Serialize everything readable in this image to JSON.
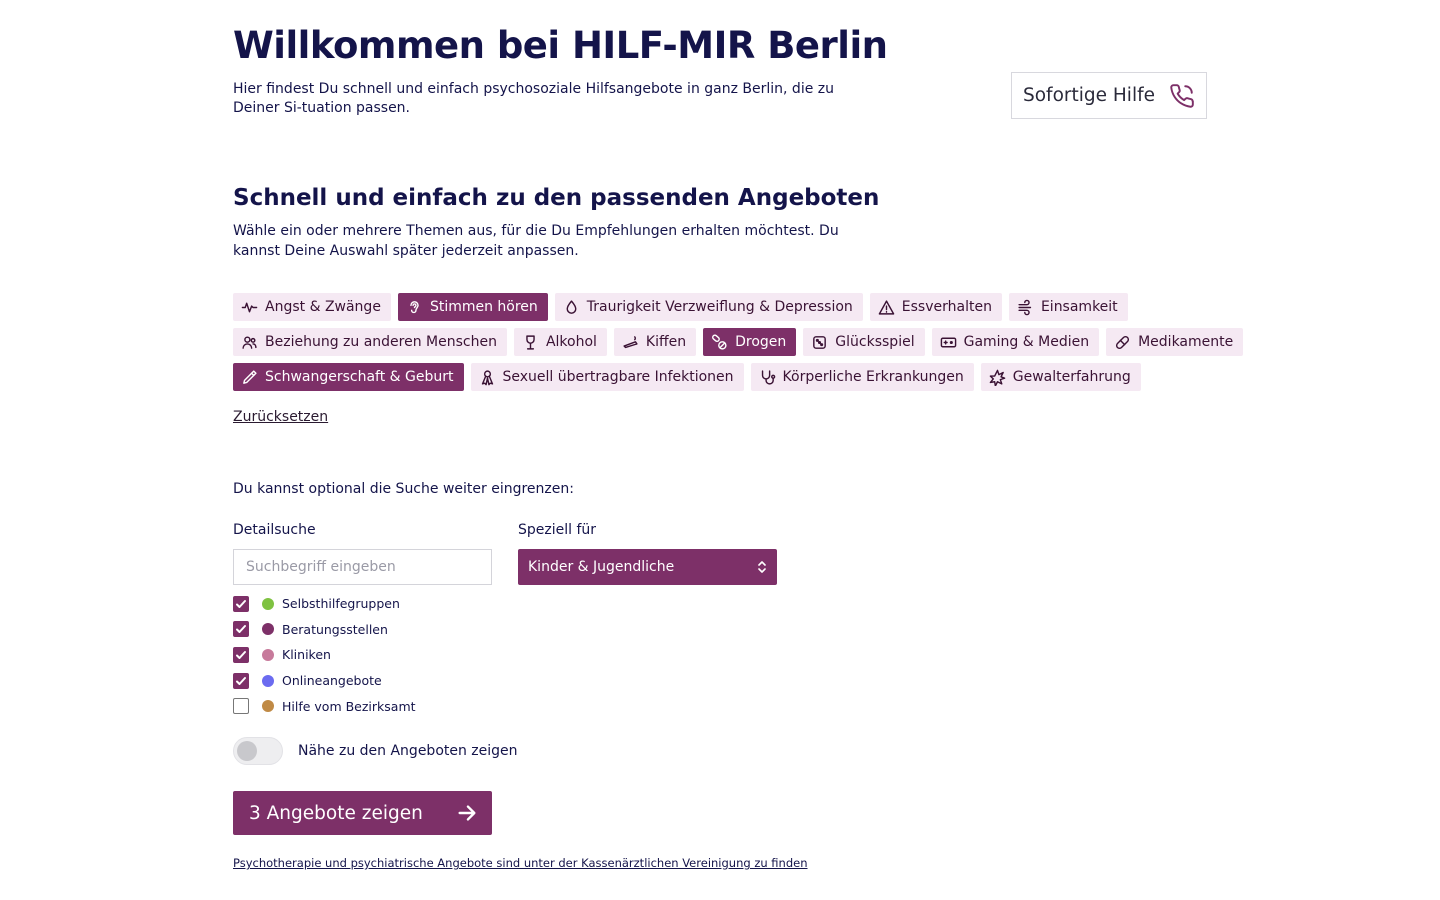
{
  "header": {
    "title": "Willkommen bei HILF-MIR Berlin",
    "intro": "Hier findest Du schnell und einfach psychosoziale Hilfsangebote in ganz Berlin, die zu Deiner Si-tuation passen.",
    "help_button": "Sofortige Hilfe",
    "help_icon": "phone-icon"
  },
  "topics": {
    "heading": "Schnell und einfach zu den passenden Angeboten",
    "description": "Wähle ein oder mehrere Themen aus, für die Du Empfehlungen erhalten möchtest. Du kannst Deine Auswahl später jederzeit anpassen.",
    "items": [
      {
        "label": "Angst & Zwänge",
        "selected": false,
        "icon": "pulse-icon"
      },
      {
        "label": "Stimmen hören",
        "selected": true,
        "icon": "ear-icon"
      },
      {
        "label": "Traurigkeit Verzweiflung & Depression",
        "selected": false,
        "icon": "drop-icon"
      },
      {
        "label": "Essverhalten",
        "selected": false,
        "icon": "warning-triangle-icon"
      },
      {
        "label": "Einsamkeit",
        "selected": false,
        "icon": "wind-icon"
      },
      {
        "label": "Beziehung zu anderen Menschen",
        "selected": false,
        "icon": "people-icon"
      },
      {
        "label": "Alkohol",
        "selected": false,
        "icon": "glass-icon"
      },
      {
        "label": "Kiffen",
        "selected": false,
        "icon": "joint-icon"
      },
      {
        "label": "Drogen",
        "selected": true,
        "icon": "pills-icon"
      },
      {
        "label": "Glücksspiel",
        "selected": false,
        "icon": "dice-icon"
      },
      {
        "label": "Gaming & Medien",
        "selected": false,
        "icon": "gamepad-icon"
      },
      {
        "label": "Medikamente",
        "selected": false,
        "icon": "capsule-icon"
      },
      {
        "label": "Schwangerschaft & Geburt",
        "selected": true,
        "icon": "pipette-icon"
      },
      {
        "label": "Sexuell übertragbare Infektionen",
        "selected": false,
        "icon": "ribbon-icon"
      },
      {
        "label": "Körperliche Erkrankungen",
        "selected": false,
        "icon": "stethoscope-icon"
      },
      {
        "label": "Gewalterfahrung",
        "selected": false,
        "icon": "burst-icon"
      }
    ],
    "reset": "Zurücksetzen"
  },
  "filters": {
    "intro": "Du kannst optional die Suche weiter eingrenzen:",
    "detail_label": "Detailsuche",
    "search_placeholder": "Suchbegriff eingeben",
    "special_label": "Speziell für",
    "special_value": "Kinder & Jugendliche",
    "types": [
      {
        "label": "Selbsthilfegruppen",
        "checked": true,
        "color": "#7fc241"
      },
      {
        "label": "Beratungsstellen",
        "checked": true,
        "color": "#7d3068"
      },
      {
        "label": "Kliniken",
        "checked": true,
        "color": "#c77a9b"
      },
      {
        "label": "Onlineangebote",
        "checked": true,
        "color": "#6b6bf0"
      },
      {
        "label": "Hilfe vom Bezirksamt",
        "checked": false,
        "color": "#c08a45"
      }
    ],
    "proximity_label": "Nähe zu den Angeboten zeigen",
    "proximity_on": false
  },
  "cta": {
    "label": "3 Angebote zeigen",
    "icon": "arrow-right-icon"
  },
  "footer_link": "Psychotherapie und psychiatrische Angebote sind unter der Kassenärztlichen Vereinigung zu finden",
  "colors": {
    "accent": "#7d3068",
    "tag_bg": "#f5e9f3",
    "text": "#14144a"
  }
}
